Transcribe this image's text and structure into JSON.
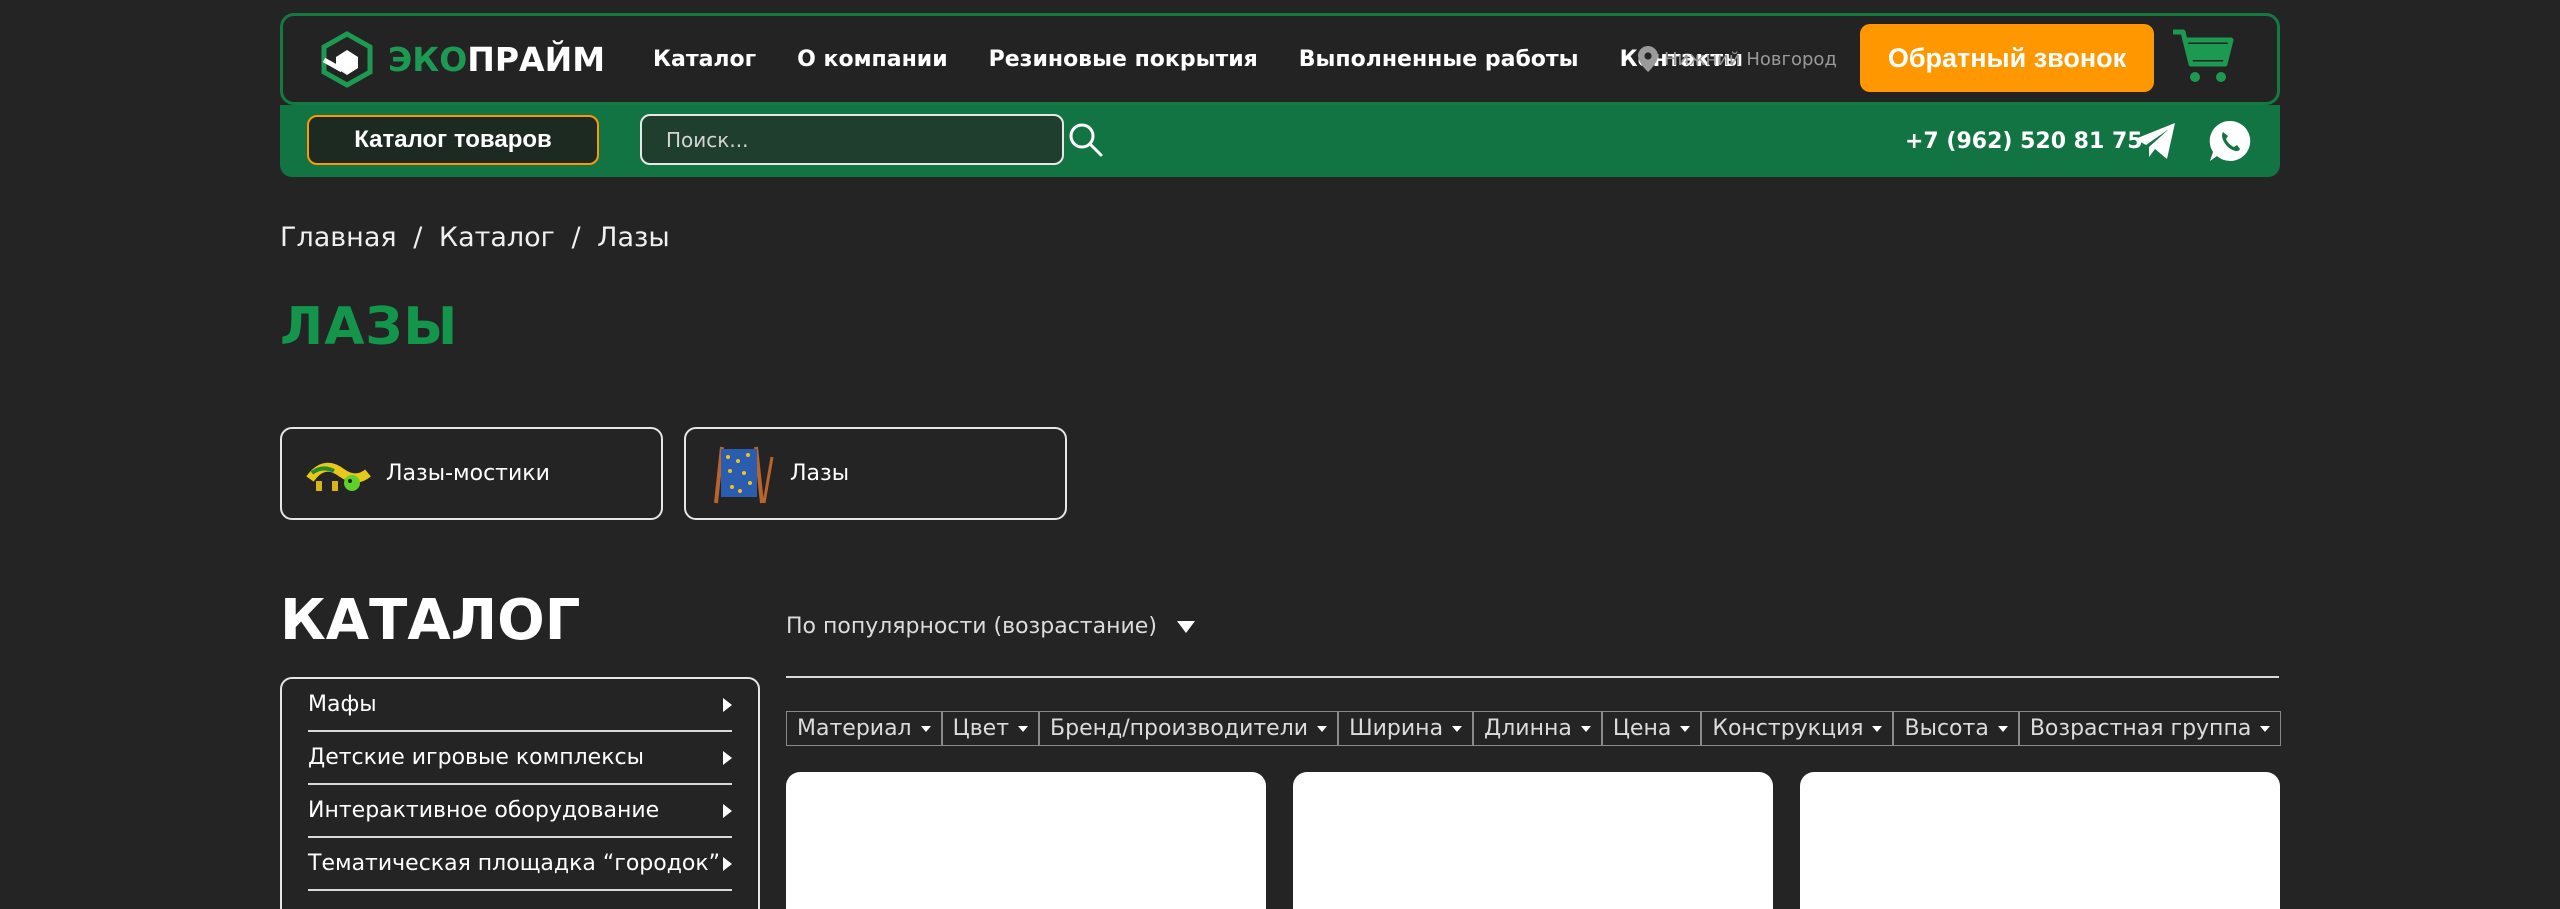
{
  "header": {
    "logo": {
      "eco": "ЭКО",
      "prime": "ПРАЙМ"
    },
    "nav": [
      "Каталог",
      "О компании",
      "Резиновые покрытия",
      "Выполненные работы",
      "Контакты"
    ],
    "city": "Нижний Новгород",
    "callback_label": "Обратный звонок",
    "catalog_btn": "Каталог товаров",
    "search_placeholder": "Поиск...",
    "phone": "+7 (962) 520 81 75"
  },
  "breadcrumb": [
    "Главная",
    "/",
    "Каталог",
    "/",
    "Лазы"
  ],
  "page_title": "ЛАЗЫ",
  "subcategories": [
    "Лазы-мостики",
    "Лазы"
  ],
  "catalog_heading": "КАТАЛОГ",
  "sidebar_items": [
    "Мафы",
    "Детские игровые комплексы",
    "Интерактивное оборудование",
    "Тематическая площадка “городок”"
  ],
  "sort_label": "По популярности (возрастание)",
  "filters": [
    "Материал",
    "Цвет",
    "Бренд/производители",
    "Ширина",
    "Длинна",
    "Цена",
    "Конструкция",
    "Высота",
    "Возрастная группа"
  ],
  "colors": {
    "accent_green": "#127b42",
    "title_green": "#13954c",
    "orange": "#ff9800",
    "background": "#242424"
  },
  "icons": [
    "logo-mark-icon",
    "location-pin-icon",
    "cart-icon",
    "search-icon",
    "telegram-icon",
    "whatsapp-icon",
    "chevron-right-icon",
    "caret-down-icon"
  ]
}
